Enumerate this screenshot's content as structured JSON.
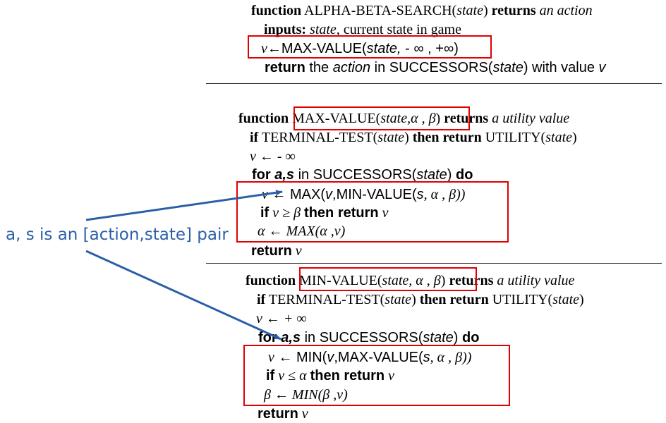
{
  "alpha_beta": {
    "kw_function": "function",
    "name": "ALPHA-BETA-SEARCH(",
    "param": "state",
    "close": ")",
    "kw_returns": "returns",
    "returns_what": "an action",
    "inputs_kw": "inputs:",
    "inputs_state": "state,",
    "inputs_desc": "current state in game",
    "assign_v": "v",
    "assign_rest": "←MAX-VALUE(",
    "assign_state": "state,",
    "assign_end": " - ∞ , +∞)",
    "return_kw": "return",
    "return_the": " the ",
    "return_action": "action",
    "return_mid": " in SUCCESSORS(",
    "return_state": "state",
    "return_tail": ") with value ",
    "return_v": "v"
  },
  "max_value": {
    "kw_function": "function",
    "sig_name": "MAX-VALUE(",
    "sig_params": "state,α , β",
    "sig_close": ")",
    "kw_returns": "returns",
    "returns_what": "a utility value",
    "if_kw": "if",
    "terminal": " TERMINAL-TEST(",
    "terminal_state": "state",
    "terminal_close": ") ",
    "then_return": "then return",
    "utility": " UTILITY(",
    "utility_state": "state",
    "utility_close": ")",
    "init": "v ← - ∞",
    "for_kw": "for",
    "for_vars": " a,s",
    "for_in": " in SUCCESSORS(",
    "for_state": "state",
    "for_close": ")",
    "do_kw": " do",
    "body1_v": "v",
    "body1_rest": " ← MAX(",
    "body1_args": "v",
    "body1_mid": ",MIN-VALUE(",
    "body1_s": "s",
    "body1_tail": ", α , β))",
    "body2_if": "if",
    "body2_cond": " v ≥ β ",
    "body2_then": "then return",
    "body2_v": " v",
    "body3": "α ← MAX(α ,v)",
    "return_kw": "return",
    "return_v": " v"
  },
  "min_value": {
    "kw_function": "function",
    "sig_name": "MIN-VALUE(",
    "sig_params": "state, α , β",
    "sig_close": ")",
    "kw_returns": "returns",
    "returns_what": "a utility value",
    "if_kw": "if",
    "terminal": " TERMINAL-TEST(",
    "terminal_state": "state",
    "terminal_close": ") ",
    "then_return": "then return",
    "utility": " UTILITY(",
    "utility_state": "state",
    "utility_close": ")",
    "init": "v ← + ∞",
    "for_kw": "for",
    "for_vars": " a,s",
    "for_in": " in SUCCESSORS(",
    "for_state": "state",
    "for_close": ")",
    "do_kw": " do",
    "body1_v": "v",
    "body1_rest": " ← MIN(",
    "body1_args": "v",
    "body1_mid": ",MAX-VALUE(",
    "body1_s": "s",
    "body1_tail": ", α , β))",
    "body2_if": "if",
    "body2_cond": " v ≤ α ",
    "body2_then": "then return",
    "body2_v": " v",
    "body3": "β ← MIN(β ,v)",
    "return_kw": "return",
    "return_v": " v"
  },
  "annotation": {
    "text": "a, s is an [action,state] pair",
    "color": "#2a5fa8"
  },
  "highlight_color": "#e00000"
}
